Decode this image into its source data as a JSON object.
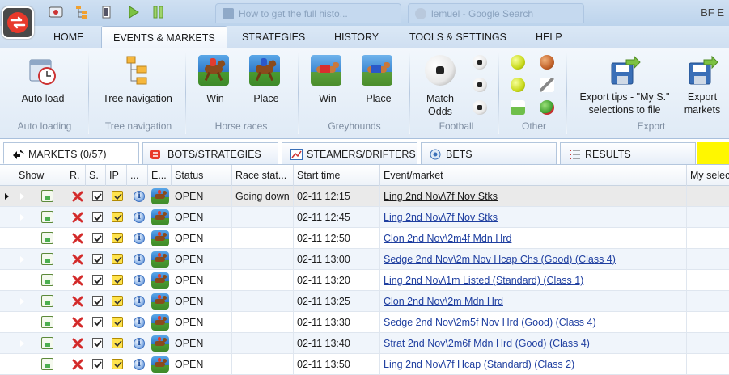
{
  "titlebar": {
    "browser_tabs": [
      "How to get the full histo...",
      "lemuel - Google Search"
    ],
    "title": "BF E"
  },
  "ribbon_tabs": [
    "HOME",
    "EVENTS & MARKETS",
    "STRATEGIES",
    "HISTORY",
    "TOOLS & SETTINGS",
    "HELP"
  ],
  "ribbon": {
    "auto_load": "Auto load",
    "auto_loading_group": "Auto loading",
    "tree_navigation": "Tree navigation",
    "tree_navigation_group": "Tree navigation",
    "horse_win": "Win",
    "horse_place": "Place",
    "horse_group": "Horse races",
    "grey_win": "Win",
    "grey_place": "Place",
    "grey_group": "Greyhounds",
    "match_odds_1": "Match",
    "match_odds_2": "Odds",
    "football_group": "Football",
    "other_group": "Other",
    "export_tips_1": "Export tips - \"My S.\"",
    "export_tips_2": "selections to file",
    "export_markets_1": "Export",
    "export_markets_2": "markets",
    "export_group": "Export"
  },
  "panel_tabs": [
    "MARKETS (0/57)",
    "BOTS/STRATEGIES",
    "STEAMERS/DRIFTERS",
    "BETS",
    "RESULTS"
  ],
  "grid": {
    "columns": [
      "Show",
      "R.",
      "S.",
      "IP",
      "...",
      "E...",
      "Status",
      "Race stat...",
      "Start time",
      "Event/market",
      "My selec"
    ],
    "rows": [
      {
        "status": "OPEN",
        "race_status": "Going down",
        "start": "02-11 12:15",
        "market": "Ling 2nd Nov\\7f Nov Stks"
      },
      {
        "status": "OPEN",
        "race_status": "",
        "start": "02-11 12:45",
        "market": "Ling 2nd Nov\\7f Nov Stks"
      },
      {
        "status": "OPEN",
        "race_status": "",
        "start": "02-11 12:50",
        "market": "Clon  2nd Nov\\2m4f Mdn Hrd"
      },
      {
        "status": "OPEN",
        "race_status": "",
        "start": "02-11 13:00",
        "market": "Sedge  2nd Nov\\2m Nov Hcap Chs (Good) (Class 4)"
      },
      {
        "status": "OPEN",
        "race_status": "",
        "start": "02-11 13:20",
        "market": "Ling 2nd Nov\\1m Listed (Standard) (Class 1)"
      },
      {
        "status": "OPEN",
        "race_status": "",
        "start": "02-11 13:25",
        "market": "Clon  2nd Nov\\2m Mdn Hrd"
      },
      {
        "status": "OPEN",
        "race_status": "",
        "start": "02-11 13:30",
        "market": "Sedge  2nd Nov\\2m5f Nov Hrd (Good) (Class 4)"
      },
      {
        "status": "OPEN",
        "race_status": "",
        "start": "02-11 13:40",
        "market": "Strat  2nd Nov\\2m6f Mdn Hrd (Good) (Class 4)"
      },
      {
        "status": "OPEN",
        "race_status": "",
        "start": "02-11 13:50",
        "market": "Ling 2nd Nov\\7f Hcap (Standard) (Class 2)"
      }
    ]
  },
  "colors": {
    "accent": "#e8392b",
    "link": "#1f3fa0",
    "highlight": "#fff700"
  }
}
